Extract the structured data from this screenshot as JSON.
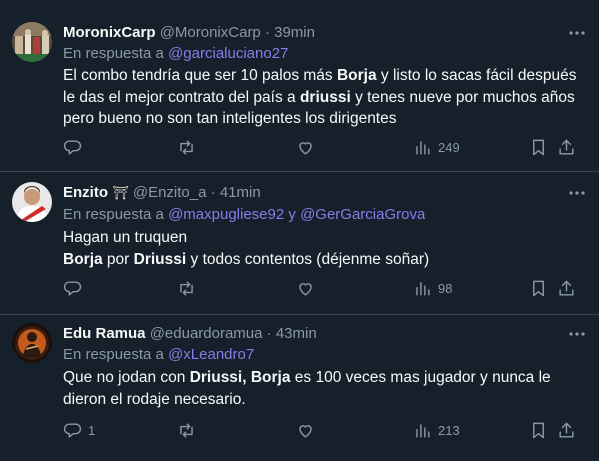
{
  "tweets": [
    {
      "name": "MoronixCarp",
      "handle": "@MoronixCarp",
      "time": "39min",
      "reply_prefix": "En respuesta a ",
      "mentions": [
        "@garcialuciano27"
      ],
      "lines": [
        [
          {
            "t": "El combo tendría que ser 10 palos más "
          },
          {
            "t": "Borja",
            "b": true
          },
          {
            "t": " y listo lo sacas fácil después"
          }
        ],
        [
          {
            "t": "le das el mejor contrato del país a "
          },
          {
            "t": "driussi",
            "b": true
          },
          {
            "t": " y tenes nueve por muchos años"
          }
        ],
        [
          {
            "t": "pero bueno no son tan inteligentes los dirigentes"
          }
        ]
      ],
      "reply_count": "",
      "retweet_count": "",
      "like_count": "",
      "views": "249"
    },
    {
      "name": "Enzito",
      "name_emoji": "⛩",
      "handle": "@Enzito_a",
      "time": "41min",
      "reply_prefix": "En respuesta a ",
      "mentions": [
        "@maxpugliese92",
        "@GerGarciaGrova"
      ],
      "mention_joiner": " y ",
      "lines": [
        [
          {
            "t": "Hagan un truquen"
          }
        ],
        [
          {
            "t": "Borja",
            "b": true
          },
          {
            "t": " por "
          },
          {
            "t": "Driussi",
            "b": true
          },
          {
            "t": " y todos contentos (déjenme soñar)"
          }
        ]
      ],
      "reply_count": "",
      "retweet_count": "",
      "like_count": "",
      "views": "98"
    },
    {
      "name": "Edu Ramua",
      "handle": "@eduardoramua",
      "time": "43min",
      "reply_prefix": "En respuesta a ",
      "mentions": [
        "@xLeandro7"
      ],
      "lines": [
        [
          {
            "t": "Que no jodan con "
          },
          {
            "t": "Driussi, Borja",
            "b": true
          },
          {
            "t": " es 100 veces mas jugador y nunca le"
          }
        ],
        [
          {
            "t": "dieron el rodaje necesario."
          }
        ]
      ],
      "reply_count": "1",
      "retweet_count": "",
      "like_count": "",
      "views": "213"
    }
  ],
  "separator": "·",
  "icons": {
    "reply": "reply-icon",
    "retweet": "retweet-icon",
    "like": "like-icon",
    "views": "views-icon",
    "bookmark": "bookmark-icon",
    "share": "share-icon",
    "more": "more-icon"
  },
  "colors": {
    "background": "#15202b",
    "text": "#f7f9f9",
    "secondary": "#8b98a5",
    "mention": "#8a7be9",
    "divider": "#38444d"
  }
}
